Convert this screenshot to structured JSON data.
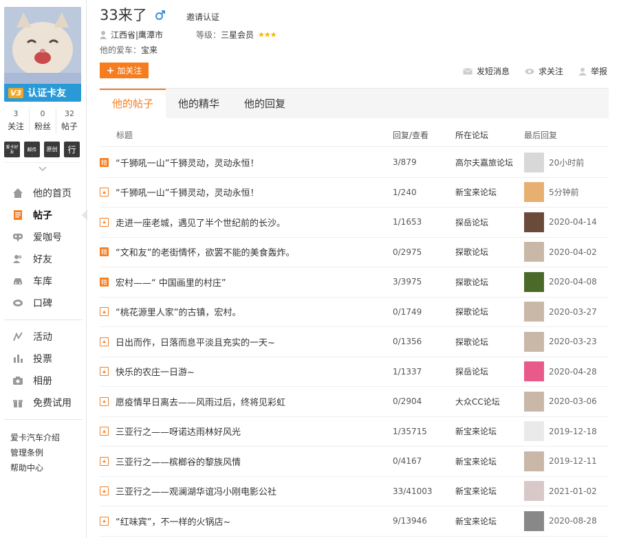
{
  "profile": {
    "name": "33来了",
    "gender_icon": "male-icon",
    "invite": "邀请认证",
    "location": "江西省|鹰潭市",
    "level_label": "等级：",
    "level_value": "三星会员",
    "stars": "★★★",
    "car_label": "他的爱车：",
    "car_value": "宝来",
    "badge_text": "V3",
    "banner_text": "认证卡友",
    "follow_btn": "加关注",
    "stats": [
      {
        "num": "3",
        "label": "关注"
      },
      {
        "num": "0",
        "label": "粉丝"
      },
      {
        "num": "32",
        "label": "帖子"
      }
    ],
    "medals": [
      "爱卡好友",
      "邮件",
      "原创",
      "行"
    ]
  },
  "actions": [
    "发短消息",
    "求关注",
    "举报"
  ],
  "nav": {
    "main": [
      {
        "label": "他的首页",
        "icon": "home-icon"
      },
      {
        "label": "帖子",
        "icon": "post-icon",
        "active": true
      },
      {
        "label": "爱咖号",
        "icon": "icafe-icon"
      },
      {
        "label": "好友",
        "icon": "friends-icon"
      },
      {
        "label": "车库",
        "icon": "garage-icon"
      },
      {
        "label": "口碑",
        "icon": "reputation-icon"
      }
    ],
    "secondary": [
      {
        "label": "活动",
        "icon": "activity-icon"
      },
      {
        "label": "投票",
        "icon": "vote-icon"
      },
      {
        "label": "相册",
        "icon": "camera-icon"
      },
      {
        "label": "免费试用",
        "icon": "gift-icon"
      }
    ],
    "footer": [
      "爱卡汽车介绍",
      "管理条例",
      "帮助中心"
    ]
  },
  "tabs": [
    "他的帖子",
    "他的精华",
    "他的回复"
  ],
  "table": {
    "headers": {
      "title": "标题",
      "reply": "回复/查看",
      "forum": "所在论坛",
      "last": "最后回复"
    },
    "rows": [
      {
        "tag": "精",
        "title": "“千狮吼一山”千狮灵动，灵动永恒！",
        "reply": "3/879",
        "forum": "高尔夫嘉旅论坛",
        "last": "20小时前",
        "thumb": "#d8d8d8"
      },
      {
        "tag": "img",
        "title": "“千狮吼一山”千狮灵动，灵动永恒！",
        "reply": "1/240",
        "forum": "新宝来论坛",
        "last": "5分钟前",
        "thumb": "#e8b070"
      },
      {
        "tag": "img",
        "title": "走进一座老城，遇见了半个世纪前的长沙。",
        "reply": "1/1653",
        "forum": "探岳论坛",
        "last": "2020-04-14",
        "thumb": "#6a4a3a"
      },
      {
        "tag": "精",
        "title": "“文和友”的老街情怀，欲罢不能的美食轰炸。",
        "reply": "0/2975",
        "forum": "探歌论坛",
        "last": "2020-04-02",
        "thumb": "#c9b8a8"
      },
      {
        "tag": "精",
        "title": "宏村——“ 中国画里的村庄”",
        "reply": "3/3975",
        "forum": "探歌论坛",
        "last": "2020-04-08",
        "thumb": "#4a6a2a"
      },
      {
        "tag": "img",
        "title": "“桃花源里人家”的古镇，宏村。",
        "reply": "0/1749",
        "forum": "探歌论坛",
        "last": "2020-03-27",
        "thumb": "#c9b8a8"
      },
      {
        "tag": "img",
        "title": "日出而作，日落而息平淡且充实的一天~",
        "reply": "0/1356",
        "forum": "探歌论坛",
        "last": "2020-03-23",
        "thumb": "#c9b8a8"
      },
      {
        "tag": "img",
        "title": "快乐的农庄一日游~",
        "reply": "1/1337",
        "forum": "探岳论坛",
        "last": "2020-04-28",
        "thumb": "#e85a8a"
      },
      {
        "tag": "img",
        "title": "愿疫情早日离去——风雨过后，终将见彩虹",
        "reply": "0/2904",
        "forum": "大众CC论坛",
        "last": "2020-03-06",
        "thumb": "#c9b8a8"
      },
      {
        "tag": "img",
        "title": "三亚行之——呀诺达雨林好风光",
        "reply": "1/35715",
        "forum": "新宝来论坛",
        "last": "2019-12-18",
        "thumb": "#eaeaea"
      },
      {
        "tag": "img",
        "title": "三亚行之——槟榔谷的黎族风情",
        "reply": "0/4167",
        "forum": "新宝来论坛",
        "last": "2019-12-11",
        "thumb": "#c9b8a8"
      },
      {
        "tag": "img",
        "title": "三亚行之——观澜湖华谊冯小刚电影公社",
        "reply": "33/41003",
        "forum": "新宝来论坛",
        "last": "2021-01-02",
        "thumb": "#d8c8c8"
      },
      {
        "tag": "img",
        "title": "“红味宾”，不一样的火锅店~",
        "reply": "9/13946",
        "forum": "新宝来论坛",
        "last": "2020-08-28",
        "thumb": "#888"
      }
    ]
  }
}
